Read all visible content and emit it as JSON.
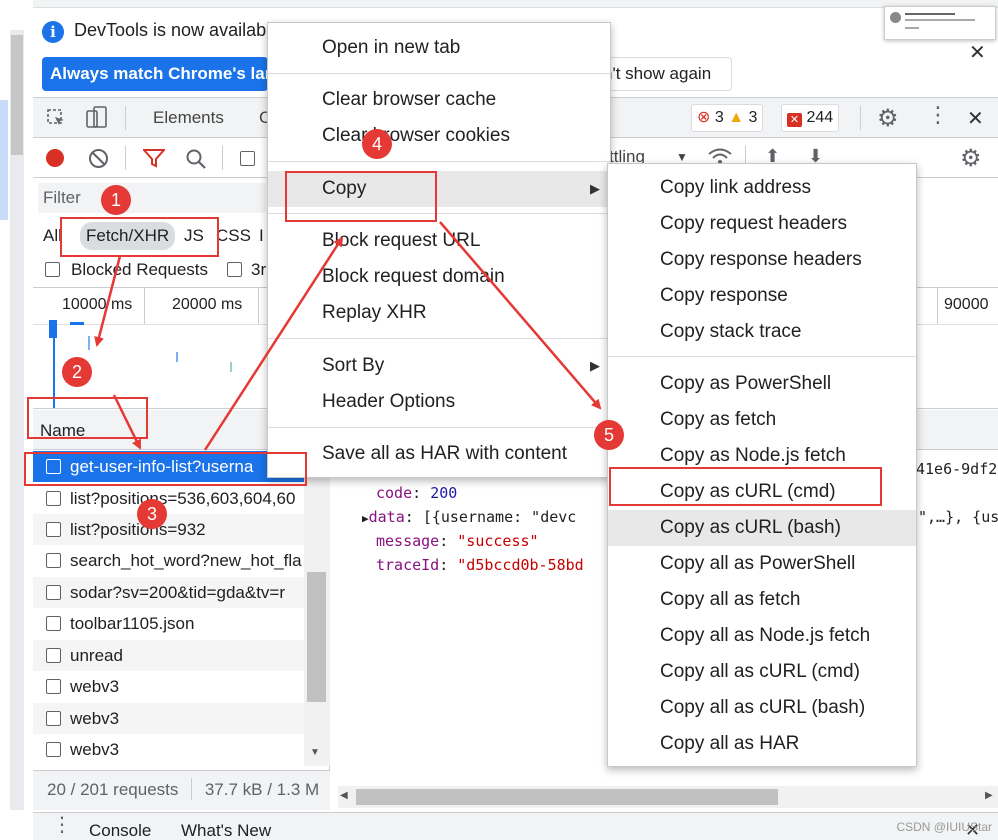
{
  "infobar": {
    "message": "DevTools is now availabl",
    "primary_button": "Always match Chrome's lar",
    "secondary_button": "n't show again"
  },
  "devtools_tabs": {
    "elements": "Elements",
    "console_partial": "C"
  },
  "status_badges": {
    "errors": "3",
    "warnings": "3",
    "issues": "244"
  },
  "throttling_partial": "ttling",
  "filter": {
    "placeholder": "Filter",
    "types": [
      "All",
      "Fetch/XHR",
      "JS",
      "CSS",
      "I"
    ],
    "blocked_requests": "Blocked Requests",
    "third_party_partial": "3r"
  },
  "overview": {
    "ticks": [
      "10000 ms",
      "20000 ms",
      "90000"
    ]
  },
  "request_list": {
    "column_name": "Name",
    "rows": [
      "get-user-info-list?userna",
      "list?positions=536,603,604,60",
      "list?positions=932",
      "search_hot_word?new_hot_fla",
      "sodar?sv=200&tid=gda&tv=r",
      "toolbar1105.json",
      "unread",
      "webv3",
      "webv3",
      "webv3"
    ],
    "summary_requests": "20 / 201 requests",
    "summary_size": "37.7 kB / 1.3 M"
  },
  "response_preview": {
    "header_partial": "41e6-9df2",
    "lines": [
      {
        "key": "code",
        "value": "200"
      },
      {
        "key": "data",
        "value": "[{username: \"devc"
      },
      {
        "key": "message",
        "value": "\"success\""
      },
      {
        "key": "traceId",
        "value": "\"d5bccd0b-58bd"
      }
    ],
    "data_tail": "\",…}, {us"
  },
  "drawer": {
    "console": "Console",
    "whats_new": "What's New"
  },
  "context_menu": {
    "items": [
      "Open in new tab",
      "Clear browser cache",
      "Clear browser cookies",
      "Copy",
      "Block request URL",
      "Block request domain",
      "Replay XHR",
      "Sort By",
      "Header Options",
      "Save all as HAR with content"
    ]
  },
  "copy_submenu": {
    "items": [
      "Copy link address",
      "Copy request headers",
      "Copy response headers",
      "Copy response",
      "Copy stack trace",
      "Copy as PowerShell",
      "Copy as fetch",
      "Copy as Node.js fetch",
      "Copy as cURL (cmd)",
      "Copy as cURL (bash)",
      "Copy all as PowerShell",
      "Copy all as fetch",
      "Copy all as Node.js fetch",
      "Copy all as cURL (cmd)",
      "Copy all as cURL (bash)",
      "Copy all as HAR"
    ]
  },
  "annotations": {
    "markers": [
      "1",
      "2",
      "3",
      "4",
      "5"
    ],
    "color": "#e53935"
  },
  "watermark": "CSDN @IUIUStar",
  "colors": {
    "accent": "#1a73e8",
    "record": "#d93025",
    "highlight": "#e8e8e8"
  }
}
